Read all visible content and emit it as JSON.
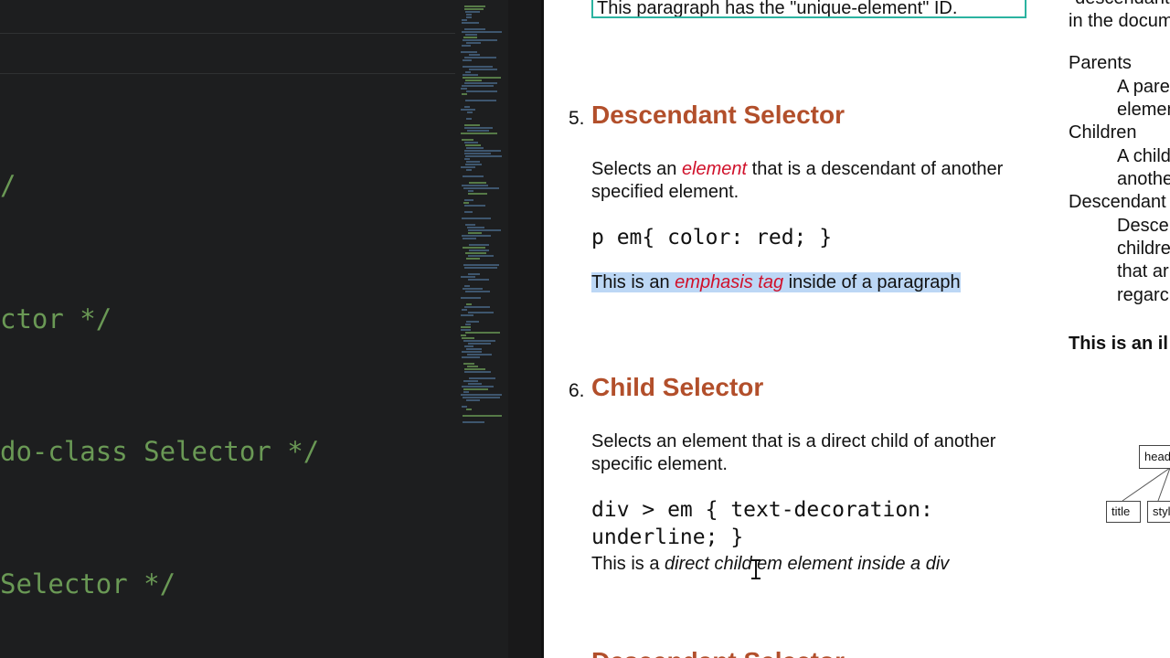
{
  "editor": {
    "code_lines": [
      {
        "text": "/"
      },
      {
        "text": "ctor */"
      },
      {
        "text": "do-class Selector */"
      },
      {
        "text": "Selector */"
      }
    ]
  },
  "document": {
    "id_example_text": "This paragraph has the \"unique-element\" ID.",
    "descendant": {
      "number": "5.",
      "title": "Descendant Selector",
      "desc_before": "Selects an ",
      "desc_em": "element",
      "desc_after": " that is a descendant of another specified element.",
      "code": "p em{ color: red; }",
      "demo_before": "This is an ",
      "demo_em": "emphasis tag",
      "demo_after": " inside of a paragraph"
    },
    "child": {
      "number": "6.",
      "title": "Child Selector",
      "desc": "Selects an element that is a direct child of another specific element.",
      "code": "div > em { text-decoration: underline; }",
      "demo_before": "This is a ",
      "demo_em": "direct child em element inside a div"
    },
    "next_title": "Descendant Selector"
  },
  "sidebar": {
    "lines": [
      {
        "text": "\"descendant"
      },
      {
        "text": "in the docum"
      },
      {
        "text": "Parents"
      },
      {
        "text": "A paren"
      },
      {
        "text": "elemen"
      },
      {
        "text": "Children"
      },
      {
        "text": "A child"
      },
      {
        "text": "anothe"
      },
      {
        "text": "Descendant"
      },
      {
        "text": "Desce"
      },
      {
        "text": "childre"
      },
      {
        "text": "that ar"
      },
      {
        "text": "regarc"
      },
      {
        "text": "This is an il"
      }
    ],
    "tree": {
      "head": "head",
      "title": "title",
      "style": "style"
    }
  }
}
